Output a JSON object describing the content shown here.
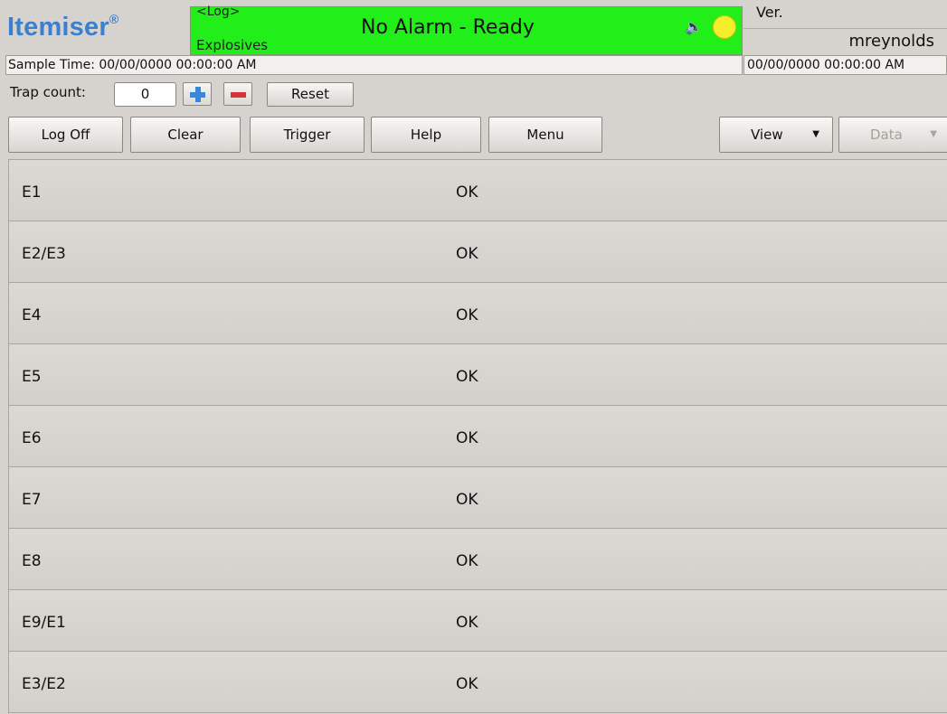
{
  "app": {
    "brand": "Itemiser",
    "brand_mark": "®",
    "log_label": "<Log>",
    "mode": "Explosives",
    "status": "No Alarm - Ready",
    "version_label": "Ver.",
    "username": "mreynolds",
    "status_color": "#22ee1a",
    "brand_color": "#3b7fcf"
  },
  "sample": {
    "text": "Sample Time: 00/00/0000  00:00:00 AM",
    "datetime": "00/00/0000  00:00:00 AM"
  },
  "trap": {
    "label": "Trap count:",
    "value": "0",
    "reset_label": "Reset"
  },
  "toolbar": {
    "logoff": "Log Off",
    "clear": "Clear",
    "trigger": "Trigger",
    "help": "Help",
    "menu": "Menu",
    "view": "View",
    "data": "Data"
  },
  "icons": {
    "speaker": "speaker-icon",
    "alarm": "alarm-light-icon",
    "plus": "plus-icon",
    "minus": "minus-icon",
    "caret": "chevron-down-icon"
  },
  "channels": [
    {
      "name": "E1",
      "status": "OK"
    },
    {
      "name": "E2/E3",
      "status": "OK"
    },
    {
      "name": "E4",
      "status": "OK"
    },
    {
      "name": "E5",
      "status": "OK"
    },
    {
      "name": "E6",
      "status": "OK"
    },
    {
      "name": "E7",
      "status": "OK"
    },
    {
      "name": "E8",
      "status": "OK"
    },
    {
      "name": "E9/E1",
      "status": "OK"
    },
    {
      "name": "E3/E2",
      "status": "OK"
    }
  ]
}
